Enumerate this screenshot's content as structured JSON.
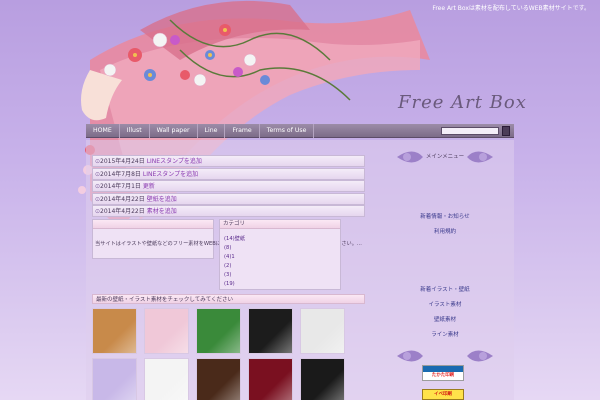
{
  "site": {
    "tagline": "Free Art Boxは素材を配布しているWEB素材サイトです。",
    "logo_text": "Free Art Box"
  },
  "nav": {
    "items": [
      {
        "label": "HOME"
      },
      {
        "label": "Illust"
      },
      {
        "label": "Wall paper"
      },
      {
        "label": "Line"
      },
      {
        "label": "Frame"
      },
      {
        "label": "Terms of Use"
      }
    ]
  },
  "news": {
    "items": [
      {
        "date": "2015年4月24日",
        "text": "LINEスタンプを追加"
      },
      {
        "date": "2014年7月8日",
        "text": "LINEスタンプを追加"
      },
      {
        "date": "2014年7月1日",
        "text": "更新"
      },
      {
        "date": "2014年4月22日",
        "text": "壁紙を追加"
      },
      {
        "date": "2014年4月22日",
        "text": "素材を追加"
      }
    ]
  },
  "intro": {
    "text": "当サイトはイラストや壁紙などのフリー素材をWEBにUPしています。ご利用の際は利用規約をお読みください。..."
  },
  "categories": {
    "title": "カテゴリ",
    "items": [
      {
        "label": "(14)壁紙"
      },
      {
        "label": "(8)"
      },
      {
        "label": "(4)1"
      },
      {
        "label": "(2)"
      },
      {
        "label": "(3)"
      },
      {
        "label": "(19)"
      }
    ]
  },
  "gallery": {
    "title": "最新の壁紙・イラスト素材をチェックしてみてください",
    "thumbs": [
      {
        "name": "dog-photo",
        "color": "#c88a4a"
      },
      {
        "name": "pink-floral-wallpaper",
        "color": "#f0c8d8"
      },
      {
        "name": "green-frog-wallpaper",
        "color": "#3a8a3a"
      },
      {
        "name": "black-floral-wallpaper",
        "color": "#1c1c1c"
      },
      {
        "name": "cow-pattern-wallpaper",
        "color": "#e8e8e8"
      },
      {
        "name": "lavender-floral-wallpaper",
        "color": "#c8b8e8"
      },
      {
        "name": "black-ribbon-wallpaper",
        "color": "#f4f4f4"
      },
      {
        "name": "chocolate-wallpaper",
        "color": "#4a2a1a"
      },
      {
        "name": "red-heart-wallpaper",
        "color": "#7a1020"
      },
      {
        "name": "spider-web-wallpaper",
        "color": "#1a1a1a"
      }
    ]
  },
  "sidebar": {
    "section1_title": "メインメニュー",
    "links1": [
      "新着情報・お知らせ",
      "利用規約"
    ],
    "links2": [
      "新着イラスト・壁紙",
      "イラスト素材",
      "壁紙素材",
      "ライン素材"
    ],
    "banner1": "たかた印刷",
    "banner2": "イベ印刷"
  },
  "colors": {
    "background_top": "#b89ee0",
    "nav_bar": "#8c7c98",
    "link": "#8a3ab0"
  }
}
